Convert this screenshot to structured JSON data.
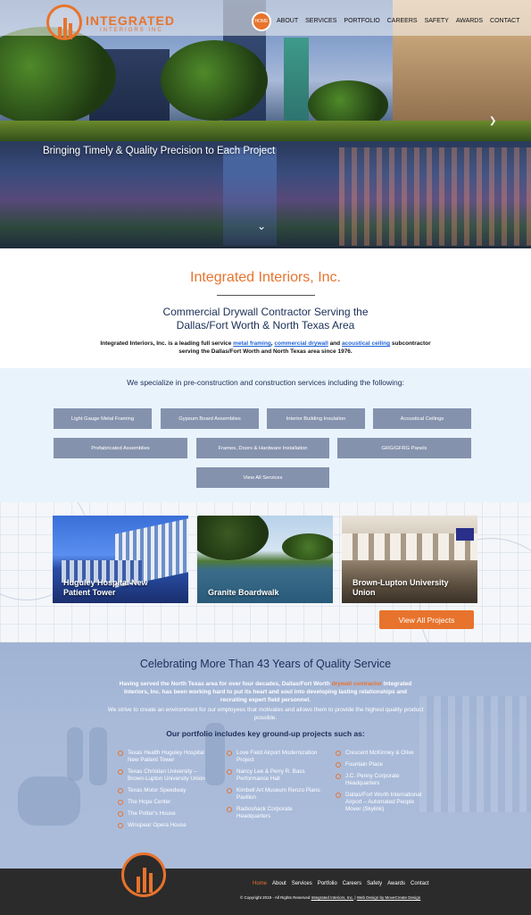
{
  "brand": {
    "name": "INTEGRATED",
    "sub": "INTERIORS INC",
    "accent": "#e8732c",
    "navy": "#1b2e57"
  },
  "nav": {
    "home_label": "HOME",
    "items": [
      "ABOUT",
      "SERVICES",
      "PORTFOLIO",
      "CAREERS",
      "SAFETY",
      "AWARDS",
      "CONTACT"
    ]
  },
  "hero": {
    "tagline": "Bringing Timely & Quality Precision to Each Project",
    "down_icon": "chevron-down-icon",
    "next_icon": "chevron-right-icon"
  },
  "intro": {
    "title": "Integrated Interiors, Inc.",
    "subtitle_line1": "Commercial Drywall Contractor Serving the",
    "subtitle_line2": "Dallas/Fort Worth & North Texas Area",
    "text_before": "Integrated Interiors, Inc. is a leading full service ",
    "link1": "metal framing",
    "sep1": ", ",
    "link2": "commercial drywall",
    "sep2": " and ",
    "link3": "acoustical ceiling",
    "text_after": " subcontractor serving the Dallas/Fort Worth and North Texas area since 1976."
  },
  "services": {
    "heading": "We specialize in pre-construction and construction services including the following:",
    "row1": [
      "Light Gauge Metal Framing",
      "Gypsum Board Assemblies",
      "Interior Building Insulation",
      "Acoustical Ceilings"
    ],
    "row2": [
      "Prefabricated Assemblies",
      "Frames, Doors & Hardware Installation",
      "GRG/GFRG Panels"
    ],
    "view_all": "View All Services"
  },
  "projects": {
    "items": [
      {
        "line1": "Huguley Hospital New",
        "line2": "Patient Tower"
      },
      {
        "line1": "Granite Boardwalk",
        "line2": ""
      },
      {
        "line1": "Brown-Lupton University",
        "line2": "Union"
      }
    ],
    "view_all": "View All Projects"
  },
  "celebrate": {
    "heading": "Celebrating More Than 43 Years of Quality Service",
    "p1_before": "Having served the North Texas area for over four decades, Dallas/Fort Worth ",
    "p1_link": "drywall contractor",
    "p1_after": " Integrated Interiors, Inc. has been working hard to put its heart and soul into developing lasting relationships and recruiting expert field personnel.",
    "p2": "We strive to create an environment for our employees that motivates and allows them to provide the highest quality product possible.",
    "portfolio_heading": "Our portfolio includes key ground-up projects such as:",
    "col1": [
      "Texas Health Huguley Hospital New Patient Tower",
      "Texas Christian University – Brown-Lupton University Union",
      "Texas Motor Speedway",
      "The Hope Center",
      "The Potter's House",
      "Winspear Opera House"
    ],
    "col2": [
      "Love Field Airport Modernization Project",
      "Nancy Lee & Perry R. Bass Performance Hall",
      "Kimbell Art Museum Renzo Piano Pavilion",
      "Radioshack Corporate Headquarters"
    ],
    "col3": [
      "Crescent McKinney & Olive",
      "Fountain Place",
      "J.C. Penny Corporate Headquarters",
      "Dallas/Fort Worth International Airport – Automated People Mover (Skylink)"
    ]
  },
  "footer": {
    "nav": [
      "Home",
      "About",
      "Services",
      "Portfolio",
      "Careers",
      "Safety",
      "Awards",
      "Contact"
    ],
    "copy_before": "© Copyright 2019 - All Rights Reserved ",
    "copy_link1": "Integrated Interiors, Inc.",
    "copy_mid": " | ",
    "copy_link2": "Web Design by MoveCreate Design"
  }
}
